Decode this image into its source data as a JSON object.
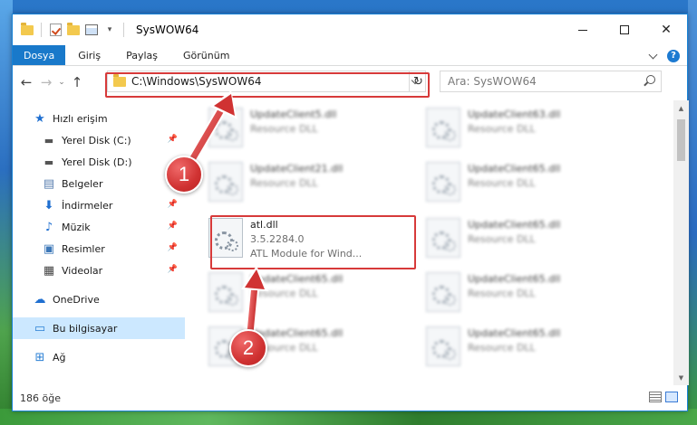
{
  "window": {
    "title": "SysWOW64"
  },
  "ribbon": {
    "tabs": [
      "Dosya",
      "Giriş",
      "Paylaş",
      "Görünüm"
    ]
  },
  "address": {
    "path": "C:\\Windows\\SysWOW64",
    "search_placeholder": "Ara: SysWOW64"
  },
  "sidebar": {
    "quick_access": "Hızlı erişim",
    "items": [
      {
        "label": "Yerel Disk (C:)",
        "icon": "drive-icon",
        "pinned": true
      },
      {
        "label": "Yerel Disk (D:)",
        "icon": "drive-icon",
        "pinned": false
      },
      {
        "label": "Belgeler",
        "icon": "documents-icon",
        "pinned": true
      },
      {
        "label": "İndirmeler",
        "icon": "download-icon",
        "pinned": true
      },
      {
        "label": "Müzik",
        "icon": "music-icon",
        "pinned": true
      },
      {
        "label": "Resimler",
        "icon": "pictures-icon",
        "pinned": true
      },
      {
        "label": "Videolar",
        "icon": "videos-icon",
        "pinned": true
      }
    ],
    "onedrive": "OneDrive",
    "this_pc": "Bu bilgisayar",
    "network": "Ağ"
  },
  "files": [
    {
      "name": "UpdateClient5.dll",
      "type": "Resource DLL",
      "blurred": true
    },
    {
      "name": "UpdateClient63.dll",
      "type": "Resource DLL",
      "blurred": true
    },
    {
      "name": "UpdateClient21.dll",
      "type": "Resource DLL",
      "blurred": true
    },
    {
      "name": "UpdateClient65.dll",
      "type": "Resource DLL",
      "blurred": true
    },
    {
      "name": "atl.dll",
      "version": "3.5.2284.0",
      "description": "ATL Module for Wind...",
      "blurred": false
    },
    {
      "name": "UpdateClient65.dll",
      "type": "Resource DLL",
      "blurred": true
    },
    {
      "name": "UpdateClient65.dll",
      "type": "Resource DLL",
      "blurred": true
    },
    {
      "name": "UpdateClient65.dll",
      "type": "Resource DLL",
      "blurred": true
    },
    {
      "name": "UpdateClient65.dll",
      "type": "Resource DLL",
      "blurred": true
    },
    {
      "name": "UpdateClient65.dll",
      "type": "Resource DLL",
      "blurred": true
    }
  ],
  "status": {
    "item_count": "186 öğe"
  },
  "annotations": {
    "step1": "1",
    "step2": "2",
    "highlight_color": "#d73a3a"
  }
}
